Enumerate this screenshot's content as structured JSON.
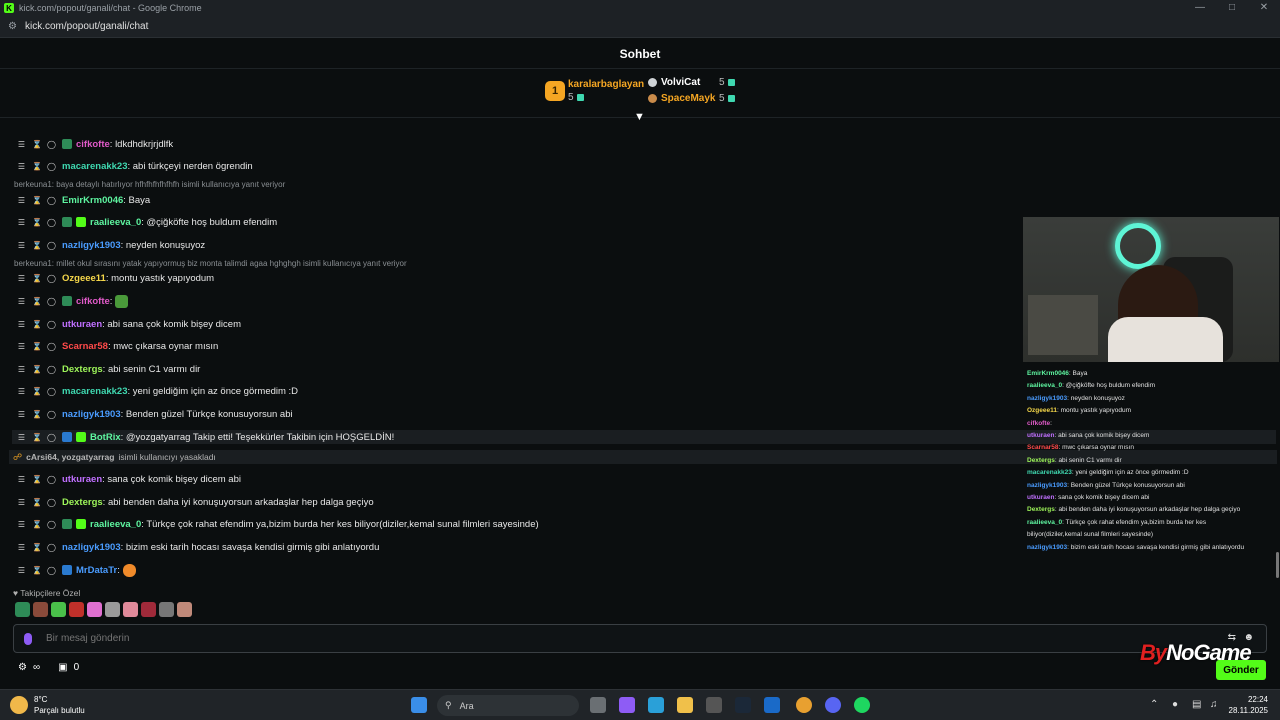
{
  "browser": {
    "title": "kick.com/popout/ganali/chat - Google Chrome",
    "url": "kick.com/popout/ganali/chat"
  },
  "chat_title": "Sohbet",
  "leaderboard": {
    "first": {
      "rank": "1",
      "name": "karalarbaglayan",
      "count": "5"
    },
    "second": {
      "name": "VolviCat",
      "count": "5"
    },
    "third": {
      "name": "SpaceMayk",
      "count": "5"
    }
  },
  "messages": [
    {
      "user": "cifkofte",
      "text": ": ldkdhdkrjrjdlfk",
      "color": "#e05ac8"
    },
    {
      "user": "macarenakk23",
      "text": ": abi türkçeyi nerden ögrendin",
      "color": "#3fd8b0"
    },
    {
      "user": "EmirKrm0046",
      "text": ": Baya",
      "color": "#5ef5a0"
    },
    {
      "user": "raalieeva_0",
      "text": ": @çiğköfte hoş buldum efendim",
      "color": "#5ef5a0"
    },
    {
      "user": "nazligyk1903",
      "text": ": neyden konuşuyoz",
      "color": "#4a9cff"
    },
    {
      "user": "Ozgeee11",
      "text": ": montu yastık yapıyodum",
      "color": "#f5d74a"
    },
    {
      "user": "cifkofte",
      "text": ":",
      "color": "#e05ac8"
    },
    {
      "user": "utkuraen",
      "text": ": abi sana çok komik bişey dicem",
      "color": "#c070ff"
    },
    {
      "user": "Scarnar58",
      "text": ": mwc çıkarsa oynar mısın",
      "color": "#ff4a4a"
    },
    {
      "user": "Dextergs",
      "text": ": abi senin C1 varmı dir",
      "color": "#9ef55a"
    },
    {
      "user": "macarenakk23",
      "text": ": yeni geldiğim için az önce görmedim :D",
      "color": "#3fd8b0"
    },
    {
      "user": "nazligyk1903",
      "text": ": Benden güzel Türkçe konusuyorsun abi",
      "color": "#4a9cff"
    },
    {
      "user": "BotRix",
      "text": ": @yozgatyarrag Takip etti! Teşekkürler Takibin için HOŞGELDİN!",
      "color": "#5ef5a0"
    },
    {
      "user": "utkuraen",
      "text": ": sana çok komik bişey dicem abi",
      "color": "#c070ff"
    },
    {
      "user": "Dextergs",
      "text": ": abi benden daha iyi konuşuyorsun arkadaşlar hep dalga geçiyo",
      "color": "#9ef55a"
    },
    {
      "user": "raalieeva_0",
      "text": ": Türkçe çok rahat efendim ya,bizim burda her kes biliyor(diziler,kemal sunal filmleri sayesinde)",
      "color": "#5ef5a0"
    },
    {
      "user": "nazligyk1903",
      "text": ": bizim eski tarih hocası savaşa kendisi girmiş gibi anlatıyordu",
      "color": "#4a9cff"
    },
    {
      "user": "MrDataTr",
      "text": ":",
      "color": "#4a9cff"
    }
  ],
  "replies": [
    "berkeuna1: baya detaylı hatırlıyor hfhfhfhfhfhfh isimli kullanıcıya yanıt veriyor",
    "berkeuna1: millet okul sırasını yatak yapıyormuş biz monta talimdi agaa hghghgh isimli kullanıcıya yanıt veriyor"
  ],
  "ban_notice": {
    "users": "cArsi64, yozgatyarrag",
    "text": "isimli kullanıcıyı yasakladı"
  },
  "followers_only": "Takipçilere Özel",
  "input": {
    "placeholder": "Bir mesaj gönderin"
  },
  "bottom": {
    "count": "0",
    "send": "Gönder"
  },
  "watermark": {
    "a": "By",
    "b": "NoGame"
  },
  "overlay": [
    {
      "user": "EmirKrm0046",
      "text": ": Baya",
      "color": "#5ef5a0"
    },
    {
      "user": "raalieeva_0",
      "text": ": @çiğköfte hoş buldum efendim",
      "color": "#5ef5a0"
    },
    {
      "user": "nazligyk1903",
      "text": ": neyden konuşuyoz",
      "color": "#4a9cff"
    },
    {
      "user": "Ozgeee11",
      "text": ": montu yastık yapıyodum",
      "color": "#f5d74a"
    },
    {
      "user": "cifkofte",
      "text": ":",
      "color": "#e05ac8"
    },
    {
      "user": "utkuraen",
      "text": ": abi sana çok komik bişey dicem",
      "color": "#c070ff"
    },
    {
      "user": "Scarnar58",
      "text": ": mwc çıkarsa oynar mısın",
      "color": "#ff4a4a"
    },
    {
      "user": "Dextergs",
      "text": ": abi senin C1 varmı dir",
      "color": "#9ef55a"
    },
    {
      "user": "macarenakk23",
      "text": ": yeni geldiğim için az önce görmedim :D",
      "color": "#3fd8b0"
    },
    {
      "user": "nazligyk1903",
      "text": ": Benden güzel Türkçe konusuyorsun abi",
      "color": "#4a9cff"
    },
    {
      "user": "utkuraen",
      "text": ": sana çok komik bişey dicem abi",
      "color": "#c070ff"
    },
    {
      "user": "Dextergs",
      "text": ": abi benden daha iyi konuşuyorsun arkadaşlar hep dalga geçiyo",
      "color": "#9ef55a"
    },
    {
      "user": "raalieeva_0",
      "text": ": Türkçe çok rahat efendim ya,bizim burda her kes",
      "color": "#5ef5a0"
    },
    {
      "user": "",
      "text": "biliyor(diziler,kemal sunal filmleri sayesinde)",
      "color": "#e0e0e0"
    },
    {
      "user": "nazligyk1903",
      "text": ": bizim eski tarih hocası savaşa kendisi girmiş gibi anlatıyordu",
      "color": "#4a9cff"
    },
    {
      "user": "MrDataTr",
      "text": ":",
      "color": "#4a9cff"
    }
  ],
  "taskbar": {
    "temp": "8°C",
    "weather": "Parçalı bulutlu",
    "search": "Ara",
    "time": "22:24",
    "date": "28.11.2025"
  },
  "colors": {
    "kick_green": "#53fc18",
    "gold": "#f5a623",
    "background": "#0b0e0f"
  }
}
